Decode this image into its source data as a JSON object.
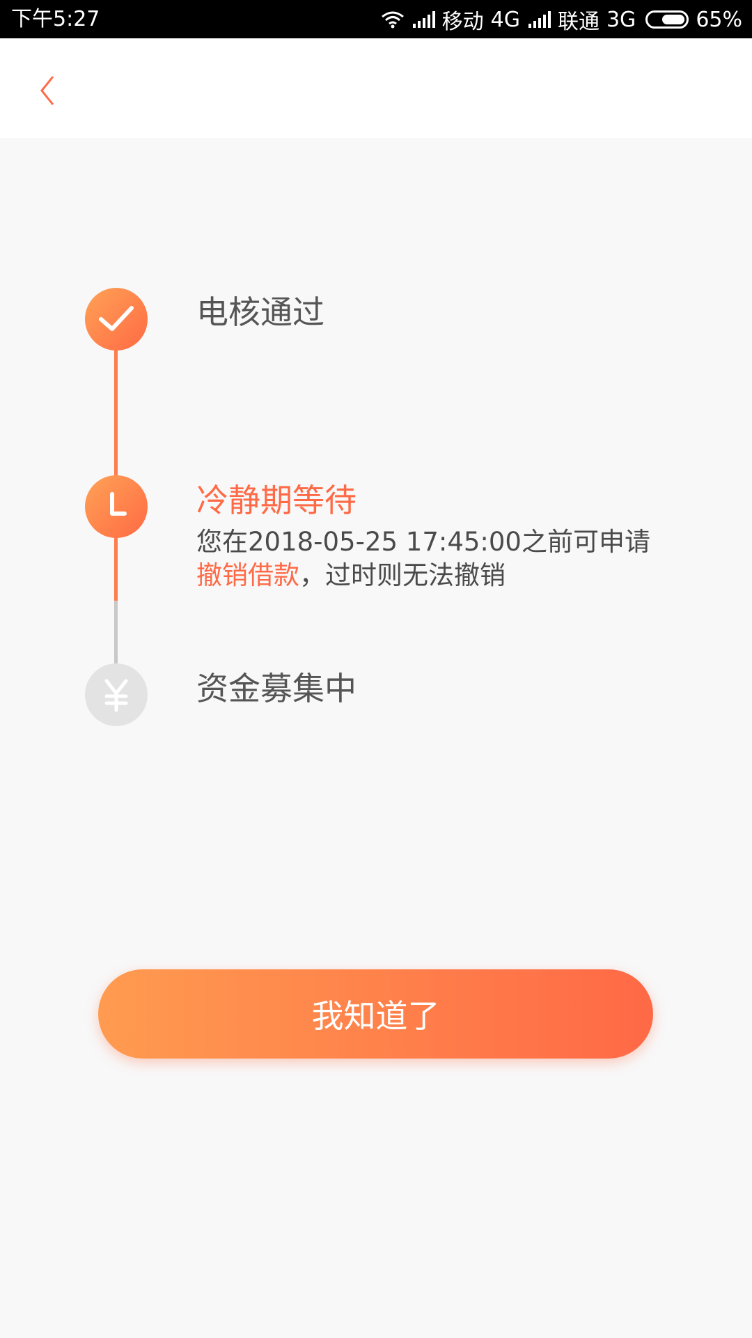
{
  "status_bar": {
    "time": "下午5:27",
    "carrier1": "移动",
    "network1": "4G",
    "carrier2": "联通",
    "network2": "3G",
    "battery": "65%",
    "battery_level": 0.65
  },
  "nav": {
    "back_icon": "chevron-left-icon",
    "accent": "#ff6a46"
  },
  "steps": [
    {
      "title": "电核通过",
      "icon": "check-icon",
      "state": "done"
    },
    {
      "title": "冷静期等待",
      "icon": "clock-icon",
      "state": "current",
      "desc_prefix": "您在2018-05-25 17:45:00之前可申请",
      "desc_link": "撤销借款",
      "desc_suffix": "，过时则无法撤销"
    },
    {
      "title": "资金募集中",
      "icon": "yen-icon",
      "state": "pending"
    }
  ],
  "confirm_button": {
    "label": "我知道了"
  },
  "colors": {
    "accent": "#ff6a46",
    "gradient_start": "#ff9b50",
    "gradient_end": "#ff6946",
    "inactive": "#e3e3e3"
  }
}
